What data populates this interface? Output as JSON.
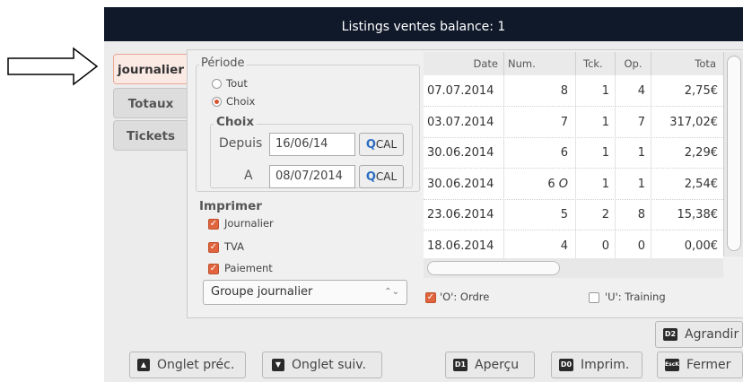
{
  "window": {
    "title": "Listings ventes balance: 1"
  },
  "tabs": [
    {
      "label": "journalier"
    },
    {
      "label": "Totaux"
    },
    {
      "label": "Tickets"
    }
  ],
  "periode": {
    "legend": "Période",
    "options": [
      {
        "label": "Tout",
        "selected": false
      },
      {
        "label": "Choix",
        "selected": true
      }
    ],
    "choix": {
      "legend": "Choix",
      "depuis_label": "Depuis",
      "depuis_value": "16/06/14",
      "a_label": "A",
      "a_value": "08/07/2014",
      "cal_label": "CAL",
      "cal_icon": "search-icon"
    }
  },
  "imprimer": {
    "legend": "Imprimer",
    "items": [
      {
        "label": "Journalier",
        "checked": true
      },
      {
        "label": "TVA",
        "checked": true
      },
      {
        "label": "Paiement",
        "checked": true
      }
    ],
    "select_value": "Groupe journalier"
  },
  "table": {
    "headers": [
      "Date",
      "Num.",
      "Tck.",
      "Op.",
      "Tota"
    ],
    "rows": [
      {
        "date": "07.07.2014",
        "num": "8",
        "tck": "1",
        "op": "4",
        "total": "2,75€"
      },
      {
        "date": "03.07.2014",
        "num": "7",
        "tck": "1",
        "op": "7",
        "total": "317,02€"
      },
      {
        "date": "30.06.2014",
        "num": "6",
        "tck": "1",
        "op": "1",
        "total": "2,29€"
      },
      {
        "date": "30.06.2014",
        "num": "6 O",
        "tck": "1",
        "op": "1",
        "total": "2,54€"
      },
      {
        "date": "23.06.2014",
        "num": "5",
        "tck": "2",
        "op": "8",
        "total": "15,38€"
      },
      {
        "date": "18.06.2014",
        "num": "4",
        "tck": "0",
        "op": "0",
        "total": "0,00€"
      }
    ]
  },
  "legend_checks": {
    "ordre": {
      "label": "'O': Ordre",
      "checked": true
    },
    "training": {
      "label": "'U': Training",
      "checked": false
    }
  },
  "buttons": {
    "agrandir": {
      "label": "Agrandir",
      "key": "D2"
    },
    "onglet_prec": {
      "label": "Onglet préc."
    },
    "onglet_suiv": {
      "label": "Onglet suiv."
    },
    "apercu": {
      "label": "Aperçu",
      "key": "D1"
    },
    "imprim": {
      "label": "Imprim.",
      "key": "D0"
    },
    "fermer": {
      "label": "Fermer",
      "key": "EscK"
    }
  },
  "colors": {
    "titlebar": "#10192a",
    "accent": "#e0643e",
    "active_tab": "#fbe9e4"
  }
}
